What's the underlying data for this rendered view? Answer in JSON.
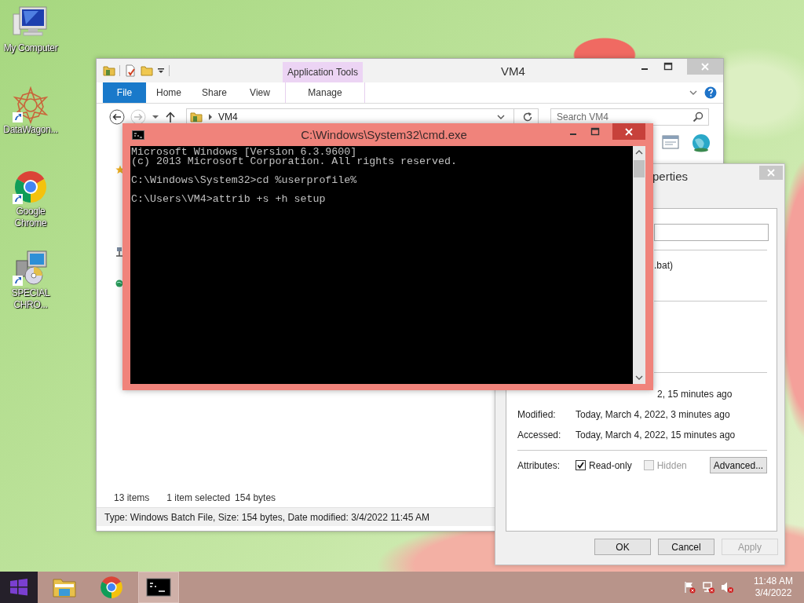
{
  "desktop_icons": [
    {
      "label": "My Computer",
      "kind": "computer"
    },
    {
      "label": "DataWagon...",
      "kind": "star"
    },
    {
      "label": "Google Chrome",
      "kind": "chrome"
    },
    {
      "label": "SPECIAL CHRO...",
      "kind": "installer"
    }
  ],
  "explorer": {
    "title": "VM4",
    "context_tab": "Application Tools",
    "ribbon_tabs": [
      {
        "label": "File",
        "kind": "file",
        "selected": false
      },
      {
        "label": "Home",
        "kind": "tab",
        "selected": false
      },
      {
        "label": "Share",
        "kind": "tab",
        "selected": false
      },
      {
        "label": "View",
        "kind": "tab",
        "selected": false
      },
      {
        "label": "Manage",
        "kind": "context",
        "selected": false
      }
    ],
    "address": "VM4",
    "search": {
      "placeholder": "Search VM4"
    },
    "status": {
      "items": "13 items",
      "selected": "1 item selected",
      "size": "154 bytes"
    },
    "details": "Type: Windows Batch File, Size: 154 bytes, Date modified: 3/4/2022 11:45 AM"
  },
  "properties": {
    "title": "perties",
    "type_fragment": ".bat)",
    "created_fragment": "2, 15 minutes ago",
    "times": [
      {
        "label": "Modified:",
        "value": "Today, March 4, 2022, 3 minutes ago"
      },
      {
        "label": "Accessed:",
        "value": "Today, March 4, 2022, 15 minutes ago"
      }
    ],
    "attributes": {
      "label": "Attributes:",
      "options": [
        {
          "label": "Read-only",
          "checked": true,
          "disabled": false
        },
        {
          "label": "Hidden",
          "checked": false,
          "disabled": true
        }
      ],
      "advanced": "Advanced..."
    },
    "buttons": [
      {
        "label": "OK",
        "disabled": false
      },
      {
        "label": "Cancel",
        "disabled": false
      },
      {
        "label": "Apply",
        "disabled": true
      }
    ]
  },
  "cmd": {
    "title": "C:\\Windows\\System32\\cmd.exe",
    "blocks": [
      [
        "Microsoft Windows [Version 6.3.9600]",
        "(c) 2013 Microsoft Corporation. All rights reserved."
      ],
      [
        "C:\\Windows\\System32>cd %userprofile%"
      ],
      [
        "C:\\Users\\VM4>attrib +s +h setup"
      ]
    ]
  },
  "taskbar": {
    "apps": [
      {
        "kind": "explorer",
        "active": false
      },
      {
        "kind": "chrome",
        "active": false
      },
      {
        "kind": "cmd",
        "active": true
      }
    ],
    "tray": [
      {
        "kind": "flag"
      },
      {
        "kind": "network"
      },
      {
        "kind": "speaker"
      }
    ],
    "time": "11:48 AM",
    "date": "3/4/2022"
  }
}
